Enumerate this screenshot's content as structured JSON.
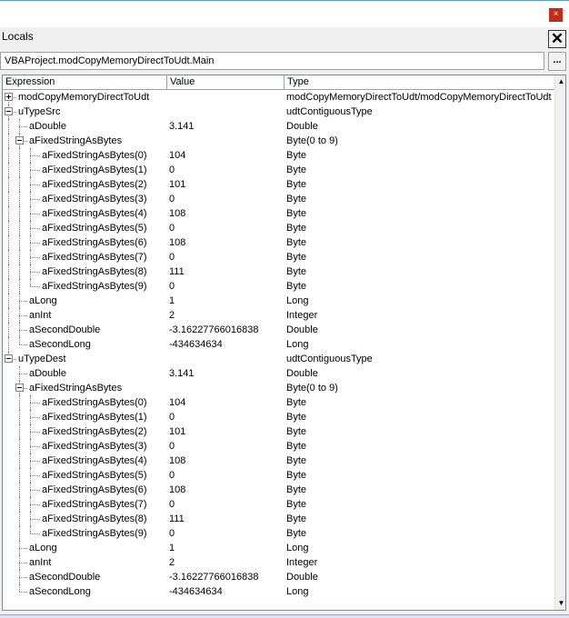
{
  "window": {
    "close_glyph": "×"
  },
  "locals": {
    "title": "Locals",
    "close_glyph": "✕",
    "context": "VBAProject.modCopyMemoryDirectToUdt.Main",
    "context_button_label": "...",
    "columns": {
      "expression": "Expression",
      "value": "Value",
      "type": "Type"
    },
    "rows": [
      {
        "level": 0,
        "toggle": "plus",
        "expr": "modCopyMemoryDirectToUdt",
        "value": "",
        "type": "modCopyMemoryDirectToUdt/modCopyMemoryDirectToUdt"
      },
      {
        "level": 0,
        "toggle": "minus",
        "expr": "uTypeSrc",
        "value": "",
        "type": "udtContiguousType"
      },
      {
        "level": 1,
        "toggle": "",
        "expr": "aDouble",
        "value": "3.141",
        "type": "Double"
      },
      {
        "level": 1,
        "toggle": "minus",
        "expr": "aFixedStringAsBytes",
        "value": "",
        "type": "Byte(0 to 9)"
      },
      {
        "level": 2,
        "toggle": "",
        "expr": "aFixedStringAsBytes(0)",
        "value": "104",
        "type": "Byte"
      },
      {
        "level": 2,
        "toggle": "",
        "expr": "aFixedStringAsBytes(1)",
        "value": "0",
        "type": "Byte"
      },
      {
        "level": 2,
        "toggle": "",
        "expr": "aFixedStringAsBytes(2)",
        "value": "101",
        "type": "Byte"
      },
      {
        "level": 2,
        "toggle": "",
        "expr": "aFixedStringAsBytes(3)",
        "value": "0",
        "type": "Byte"
      },
      {
        "level": 2,
        "toggle": "",
        "expr": "aFixedStringAsBytes(4)",
        "value": "108",
        "type": "Byte"
      },
      {
        "level": 2,
        "toggle": "",
        "expr": "aFixedStringAsBytes(5)",
        "value": "0",
        "type": "Byte"
      },
      {
        "level": 2,
        "toggle": "",
        "expr": "aFixedStringAsBytes(6)",
        "value": "108",
        "type": "Byte"
      },
      {
        "level": 2,
        "toggle": "",
        "expr": "aFixedStringAsBytes(7)",
        "value": "0",
        "type": "Byte"
      },
      {
        "level": 2,
        "toggle": "",
        "expr": "aFixedStringAsBytes(8)",
        "value": "111",
        "type": "Byte"
      },
      {
        "level": 2,
        "toggle": "",
        "expr": "aFixedStringAsBytes(9)",
        "value": "0",
        "type": "Byte"
      },
      {
        "level": 1,
        "toggle": "",
        "expr": "aLong",
        "value": "1",
        "type": "Long"
      },
      {
        "level": 1,
        "toggle": "",
        "expr": "anInt",
        "value": "2",
        "type": "Integer"
      },
      {
        "level": 1,
        "toggle": "",
        "expr": "aSecondDouble",
        "value": "-3.16227766016838",
        "type": "Double"
      },
      {
        "level": 1,
        "toggle": "",
        "expr": "aSecondLong",
        "value": "-434634634",
        "type": "Long"
      },
      {
        "level": 0,
        "toggle": "minus",
        "expr": "uTypeDest",
        "value": "",
        "type": "udtContiguousType"
      },
      {
        "level": 1,
        "toggle": "",
        "expr": "aDouble",
        "value": "3.141",
        "type": "Double"
      },
      {
        "level": 1,
        "toggle": "minus",
        "expr": "aFixedStringAsBytes",
        "value": "",
        "type": "Byte(0 to 9)"
      },
      {
        "level": 2,
        "toggle": "",
        "expr": "aFixedStringAsBytes(0)",
        "value": "104",
        "type": "Byte"
      },
      {
        "level": 2,
        "toggle": "",
        "expr": "aFixedStringAsBytes(1)",
        "value": "0",
        "type": "Byte"
      },
      {
        "level": 2,
        "toggle": "",
        "expr": "aFixedStringAsBytes(2)",
        "value": "101",
        "type": "Byte"
      },
      {
        "level": 2,
        "toggle": "",
        "expr": "aFixedStringAsBytes(3)",
        "value": "0",
        "type": "Byte"
      },
      {
        "level": 2,
        "toggle": "",
        "expr": "aFixedStringAsBytes(4)",
        "value": "108",
        "type": "Byte"
      },
      {
        "level": 2,
        "toggle": "",
        "expr": "aFixedStringAsBytes(5)",
        "value": "0",
        "type": "Byte"
      },
      {
        "level": 2,
        "toggle": "",
        "expr": "aFixedStringAsBytes(6)",
        "value": "108",
        "type": "Byte"
      },
      {
        "level": 2,
        "toggle": "",
        "expr": "aFixedStringAsBytes(7)",
        "value": "0",
        "type": "Byte"
      },
      {
        "level": 2,
        "toggle": "",
        "expr": "aFixedStringAsBytes(8)",
        "value": "111",
        "type": "Byte"
      },
      {
        "level": 2,
        "toggle": "",
        "expr": "aFixedStringAsBytes(9)",
        "value": "0",
        "type": "Byte"
      },
      {
        "level": 1,
        "toggle": "",
        "expr": "aLong",
        "value": "1",
        "type": "Long"
      },
      {
        "level": 1,
        "toggle": "",
        "expr": "anInt",
        "value": "2",
        "type": "Integer"
      },
      {
        "level": 1,
        "toggle": "",
        "expr": "aSecondDouble",
        "value": "-3.16227766016838",
        "type": "Double"
      },
      {
        "level": 1,
        "toggle": "",
        "expr": "aSecondLong",
        "value": "-434634634",
        "type": "Long"
      }
    ]
  },
  "scrollbar": {
    "up_glyph": "▲",
    "down_glyph": "▼"
  }
}
